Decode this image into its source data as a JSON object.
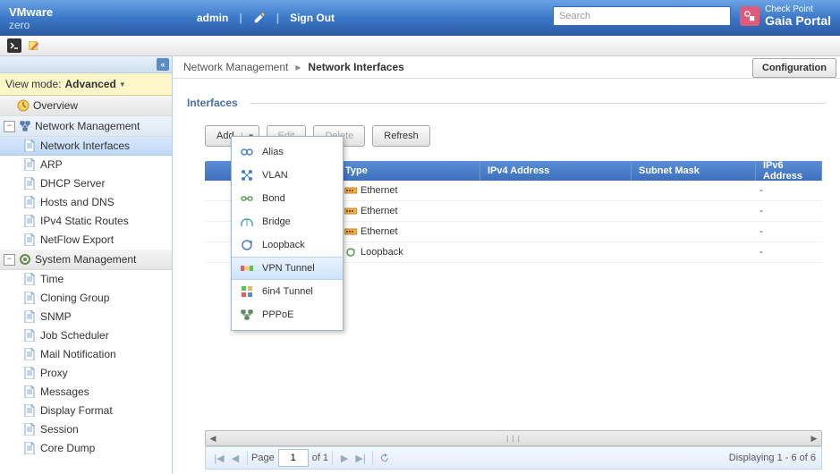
{
  "top": {
    "vmware": "VMware",
    "hostname": "zero",
    "admin": "admin",
    "signout": "Sign Out",
    "search_placeholder": "Search",
    "checkpoint": "Check Point",
    "gaia": "Gaia Portal"
  },
  "sidebar": {
    "view_mode_label": "View mode:",
    "view_mode_value": "Advanced",
    "sections": [
      {
        "label": "Overview",
        "expandable": false,
        "items": []
      },
      {
        "label": "Network Management",
        "items": [
          "Network Interfaces",
          "ARP",
          "DHCP Server",
          "Hosts and DNS",
          "IPv4 Static Routes",
          "NetFlow Export"
        ]
      },
      {
        "label": "System Management",
        "items": [
          "Time",
          "Cloning Group",
          "SNMP",
          "Job Scheduler",
          "Mail Notification",
          "Proxy",
          "Messages",
          "Display Format",
          "Session",
          "Core Dump"
        ]
      }
    ]
  },
  "breadcrumb": {
    "parent": "Network Management",
    "current": "Network Interfaces",
    "config_btn": "Configuration"
  },
  "panel": {
    "title": "Interfaces",
    "buttons": {
      "add": "Add",
      "edit": "Edit",
      "delete": "Delete",
      "refresh": "Refresh"
    },
    "add_menu": [
      "Alias",
      "VLAN",
      "Bond",
      "Bridge",
      "Loopback",
      "VPN Tunnel",
      "6in4 Tunnel",
      "PPPoE"
    ],
    "add_menu_hover_index": 5,
    "columns": {
      "type": "Type",
      "ipv4": "IPv4 Address",
      "mask": "Subnet Mask",
      "ipv6": "IPv6 Address"
    },
    "rows": [
      {
        "type": "Ethernet",
        "ipv4": "",
        "mask": "",
        "ipv6": "-"
      },
      {
        "type": "Ethernet",
        "ipv4": "",
        "mask": "",
        "ipv6": "-"
      },
      {
        "type": "Ethernet",
        "ipv4": "",
        "mask": "",
        "ipv6": "-"
      },
      {
        "type": "Loopback",
        "ipv4": "",
        "mask": "",
        "ipv6": "-"
      }
    ]
  },
  "pager": {
    "page_label": "Page",
    "page": "1",
    "of": "of 1",
    "status": "Displaying 1 - 6 of 6"
  }
}
